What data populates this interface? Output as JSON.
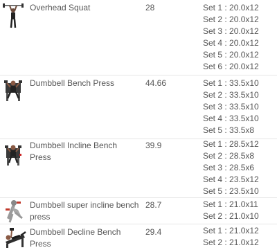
{
  "exercises": [
    {
      "icon": "overhead-squat-figure-icon",
      "name": "Overhead Squat",
      "value": "28",
      "sets": [
        "Set 1 : 20.0x12",
        "Set 2 : 20.0x12",
        "Set 3 : 20.0x12",
        "Set 4 : 20.0x12",
        "Set 5 : 20.0x12",
        "Set 6 : 20.0x12"
      ]
    },
    {
      "icon": "dumbbell-bench-press-figure-icon",
      "name": "Dumbbell Bench Press",
      "value": "44.66",
      "sets": [
        "Set 1 : 33.5x10",
        "Set 2 : 33.5x10",
        "Set 3 : 33.5x10",
        "Set 4 : 33.5x10",
        "Set 5 : 33.5x8"
      ]
    },
    {
      "icon": "dumbbell-incline-bench-press-figure-icon",
      "name": "Dumbbell Incline Bench Press",
      "value": "39.9",
      "sets": [
        "Set 1 : 28.5x12",
        "Set 2 : 28.5x8",
        "Set 3 : 28.5x6",
        "Set 4 : 23.5x12",
        "Set 5 : 23.5x10"
      ]
    },
    {
      "icon": "dumbbell-super-incline-figure-icon",
      "name": "Dumbbell super incline bench press",
      "value": "28.7",
      "sets": [
        "Set 1 : 21.0x11",
        "Set 2 : 21.0x10"
      ]
    },
    {
      "icon": "dumbbell-decline-bench-press-figure-icon",
      "name": "Dumbbell Decline Bench Press",
      "value": "29.4",
      "sets": [
        "Set 1 : 21.0x12",
        "Set 2 : 21.0x12"
      ]
    }
  ]
}
